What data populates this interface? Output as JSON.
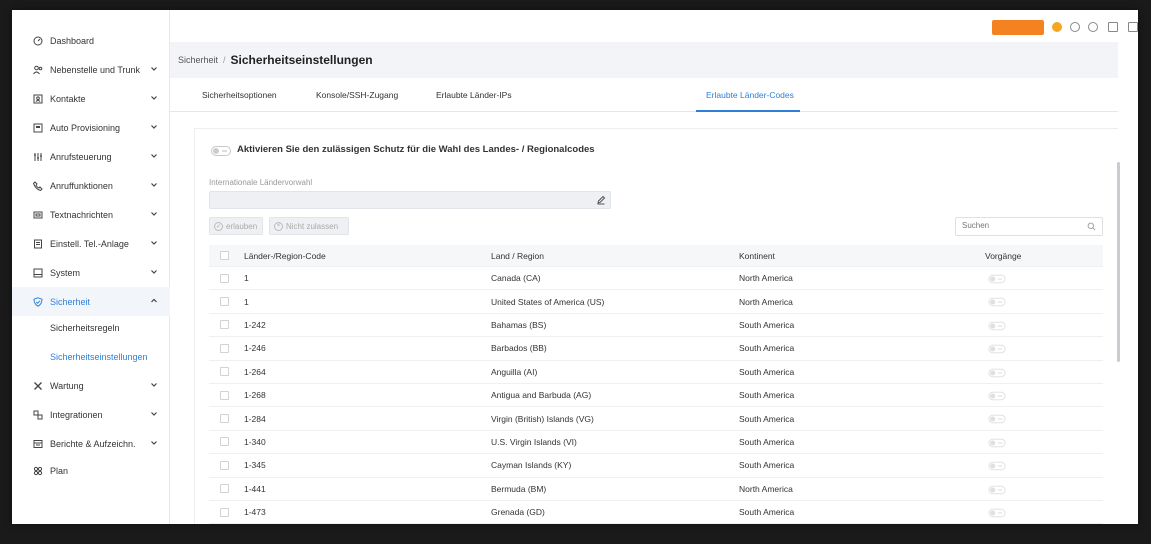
{
  "sidebar": {
    "items": [
      {
        "label": "Dashboard",
        "icon": "gauge-icon",
        "expandable": false
      },
      {
        "label": "Nebenstelle und Trunk",
        "icon": "users-icon",
        "expandable": true
      },
      {
        "label": "Kontakte",
        "icon": "contacts-icon",
        "expandable": true
      },
      {
        "label": "Auto Provisioning",
        "icon": "provision-icon",
        "expandable": true
      },
      {
        "label": "Anrufsteuerung",
        "icon": "call-control-icon",
        "expandable": true
      },
      {
        "label": "Anruffunktionen",
        "icon": "phone-icon",
        "expandable": true
      },
      {
        "label": "Textnachrichten",
        "icon": "message-icon",
        "expandable": true
      },
      {
        "label": "Einstell. Tel.-Anlage",
        "icon": "settings-doc-icon",
        "expandable": true
      },
      {
        "label": "System",
        "icon": "monitor-icon",
        "expandable": true
      },
      {
        "label": "Sicherheit",
        "icon": "shield-icon",
        "expandable": true,
        "active": true
      },
      {
        "label": "Wartung",
        "icon": "tools-icon",
        "expandable": true
      },
      {
        "label": "Integrationen",
        "icon": "integration-icon",
        "expandable": true
      },
      {
        "label": "Berichte & Aufzeichn.",
        "icon": "report-icon",
        "expandable": true
      },
      {
        "label": "Plan",
        "icon": "plan-icon",
        "expandable": false
      }
    ],
    "sub_items": [
      {
        "label": "Sicherheitsregeln",
        "active": false
      },
      {
        "label": "Sicherheitseinstellungen",
        "active": true
      }
    ]
  },
  "breadcrumb": {
    "parent": "Sicherheit",
    "separator": "/",
    "current": "Sicherheitseinstellungen"
  },
  "tabs": [
    {
      "label": "Sicherheitsoptionen",
      "active": false
    },
    {
      "label": "Konsole/SSH-Zugang",
      "active": false
    },
    {
      "label": "Erlaubte Länder-IPs",
      "active": false
    },
    {
      "label": "Erlaubte Länder-Codes",
      "active": true
    }
  ],
  "content": {
    "toggle_label": "Aktivieren Sie den zulässigen Schutz für die Wahl des Landes- / Regionalcodes",
    "field_label": "Internationale Ländervorwahl",
    "field_value": "",
    "allow_button": "erlauben",
    "deny_button": "Nicht zulassen",
    "search_placeholder": "Suchen"
  },
  "table": {
    "headers": [
      "Länder-/Region-Code",
      "Land / Region",
      "Kontinent",
      "Vorgänge"
    ],
    "rows": [
      {
        "code": "1",
        "country": "Canada (CA)",
        "continent": "North America"
      },
      {
        "code": "1",
        "country": "United States of America (US)",
        "continent": "North America"
      },
      {
        "code": "1-242",
        "country": "Bahamas (BS)",
        "continent": "South America"
      },
      {
        "code": "1-246",
        "country": "Barbados (BB)",
        "continent": "South America"
      },
      {
        "code": "1-264",
        "country": "Anguilla (AI)",
        "continent": "South America"
      },
      {
        "code": "1-268",
        "country": "Antigua and Barbuda (AG)",
        "continent": "South America"
      },
      {
        "code": "1-284",
        "country": "Virgin (British) Islands (VG)",
        "continent": "South America"
      },
      {
        "code": "1-340",
        "country": "U.S. Virgin Islands (VI)",
        "continent": "South America"
      },
      {
        "code": "1-345",
        "country": "Cayman Islands (KY)",
        "continent": "South America"
      },
      {
        "code": "1-441",
        "country": "Bermuda (BM)",
        "continent": "North America"
      },
      {
        "code": "1-473",
        "country": "Grenada (GD)",
        "continent": "South America"
      }
    ]
  },
  "colors": {
    "accent": "#2f7fd6",
    "header_button": "#f58220"
  }
}
